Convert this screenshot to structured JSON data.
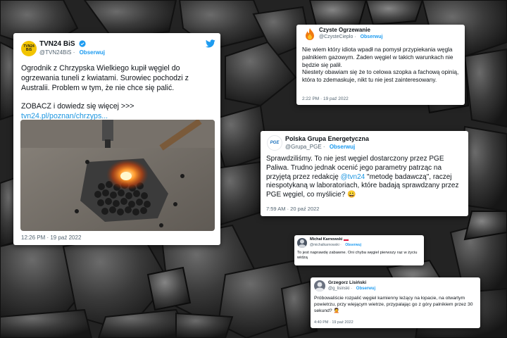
{
  "tweet1": {
    "name": "TVN24 BiS",
    "handle": "@TVN24BiS",
    "follow": "Obserwuj",
    "avatar_text": "TVN24 BiS",
    "line1": "Ogrodnik z Chrzypska Wielkiego kupił węgiel do ogrzewania tuneli z kwiatami. Surowiec pochodzi z Australii. Problem w tym, że nie chce się palić.",
    "line2": "ZOBACZ i dowiedz się więcej >>>",
    "link": "tvn24.pl/poznan/chrzyps...",
    "time": "12:26 PM · 19 paź 2022"
  },
  "tweet2": {
    "name": "Czyste Ogrzewanie",
    "handle": "@CzysteCieplo",
    "follow": "Obserwuj",
    "text1": "Nie wiem który idiota wpadł na pomysł przypiekania węgla palnikiem gazowym. Żaden węgiel w takich warunkach nie będzie się palił.",
    "text2": "Niestety obawiam się że to celowa szopka a fachową opinią, która to zdemaskuje, nikt tu nie jest zainteresowany.",
    "time": "2:22 PM · 19 paź 2022"
  },
  "tweet3": {
    "name": "Polska Grupa Energetyczna",
    "handle": "@Grupa_PGE",
    "follow": "Obserwuj",
    "avatar_text": "PGE",
    "text_a": "Sprawdziliśmy. To nie jest węgiel dostarczony przez PGE Paliwa. Trudno jednak ocenić jego parametry patrząc na przyjętą przez redakcję ",
    "mention": "@tvn24",
    "text_b": " \"metodę badawczą\", raczej niespotykaną w laboratoriach, które badają sprawdzany przez PGE węgiel, co myślicie? 😀",
    "time": "7:59 AM · 20 paź 2022"
  },
  "tweet4": {
    "name": "Michał Karnowski",
    "handle": "@michalkarnowski",
    "follow": "Obserwuj",
    "text": "To jest naprawdę zabawne. Oni chyba węgiel pierwszy raz w życiu widzą"
  },
  "tweet5": {
    "name": "Grzegorz Lisiński",
    "handle": "@g_lisinski",
    "follow": "Obserwuj",
    "text": "Próbowaliście rozpalić węgiel kamienny leżący na łopacie, na otwartym powietrzu, przy wiejącym wietrze, przypalając go z góry palnikiem przez 30 sekund? 🤦",
    "time": "4:40 PM · 19 paź 2022"
  },
  "colors": {
    "accent": "#1d9bf0",
    "link": "#1b95e0",
    "muted": "#536471"
  }
}
